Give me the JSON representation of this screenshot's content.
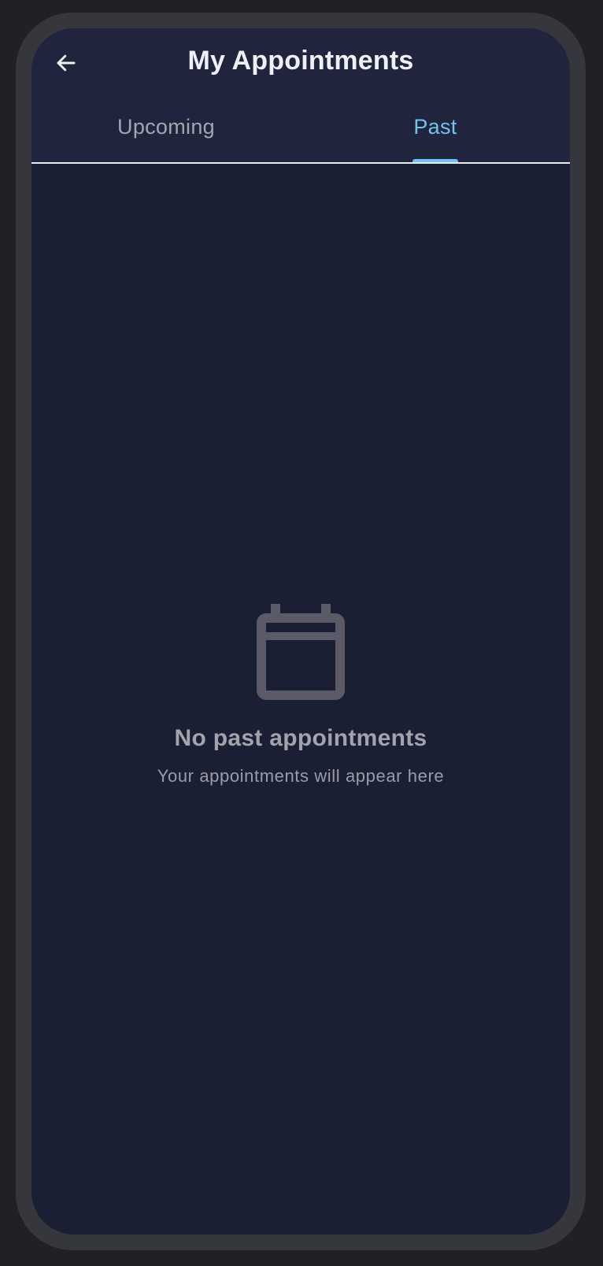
{
  "header": {
    "title": "My Appointments",
    "back_icon": "arrow-left-icon"
  },
  "tabs": [
    {
      "label": "Upcoming",
      "active": false
    },
    {
      "label": "Past",
      "active": true
    }
  ],
  "empty_state": {
    "icon": "calendar-icon",
    "title": "No past appointments",
    "subtitle": "Your appointments will appear here"
  },
  "colors": {
    "background": "#1b1f33",
    "appbar": "#20253d",
    "accent": "#6fc3ee",
    "muted_text": "#a2a3ab",
    "icon_muted": "#5a5b66"
  }
}
